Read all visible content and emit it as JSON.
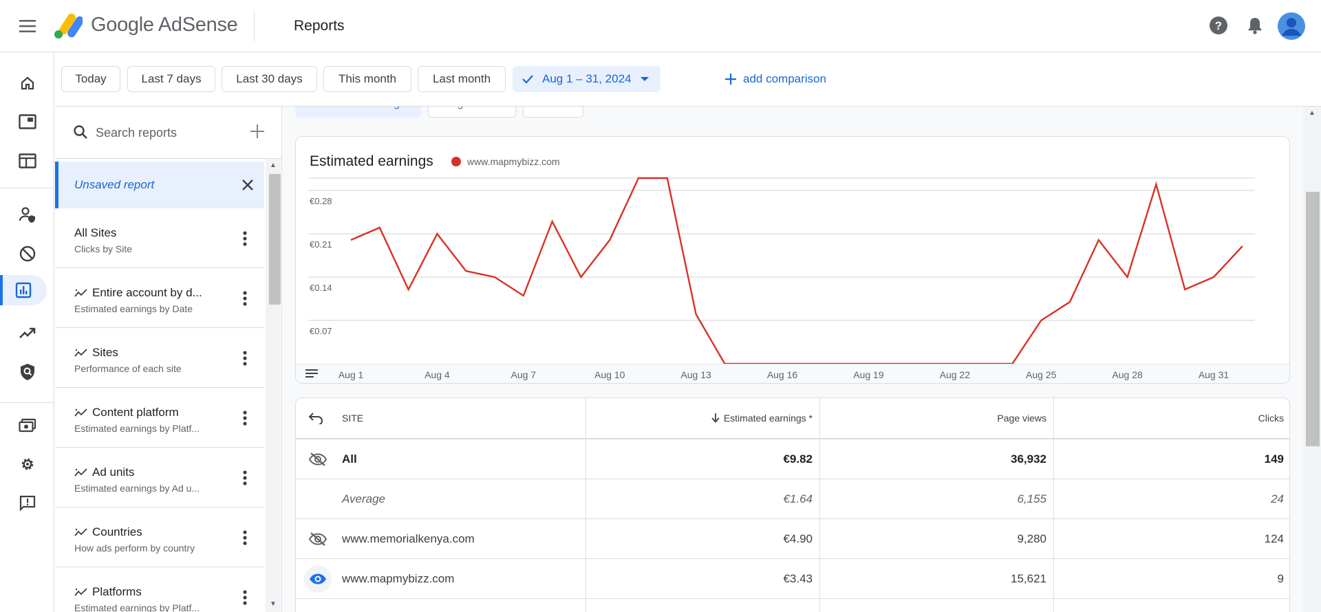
{
  "app": {
    "brand": "Google AdSense",
    "page_title": "Reports"
  },
  "icons": {
    "menu": "menu-icon",
    "help": "help-icon",
    "notifications": "bell-icon",
    "account": "avatar-icon",
    "rail": [
      "home-icon",
      "ad-unit-icon",
      "site-layout-icon",
      "privacy-user-icon",
      "block-icon",
      "reports-icon",
      "trending-icon",
      "policy-shield-icon",
      "payments-icon",
      "settings-icon",
      "feedback-icon"
    ]
  },
  "filters": {
    "chips": [
      "Today",
      "Last 7 days",
      "Last 30 days",
      "This month",
      "Last month"
    ],
    "selected_range": "Aug 1 – 31, 2024",
    "add_comparison": "add comparison"
  },
  "reports_panel": {
    "search_placeholder": "Search reports",
    "unsaved_label": "Unsaved report",
    "items": [
      {
        "title": "All Sites",
        "subtitle": "Clicks by Site",
        "pinned": false
      },
      {
        "title": "Entire account by d...",
        "subtitle": "Estimated earnings by Date",
        "pinned": true
      },
      {
        "title": "Sites",
        "subtitle": "Performance of each site",
        "pinned": true
      },
      {
        "title": "Content platform",
        "subtitle": "Estimated earnings by Platf...",
        "pinned": true
      },
      {
        "title": "Ad units",
        "subtitle": "Estimated earnings by Ad u...",
        "pinned": true
      },
      {
        "title": "Countries",
        "subtitle": "How ads perform by country",
        "pinned": true
      },
      {
        "title": "Platforms",
        "subtitle": "Estimated earnings by Platf...",
        "pinned": true
      }
    ]
  },
  "metric_tabs": [
    "Estimated earnings",
    "Page views",
    "Clicks"
  ],
  "chart_data": {
    "type": "line",
    "title": "Estimated earnings",
    "series": [
      {
        "name": "www.mapmybizz.com",
        "color": "#d93025",
        "values": [
          0.2,
          0.22,
          0.12,
          0.21,
          0.15,
          0.14,
          0.11,
          0.23,
          0.14,
          0.2,
          0.3,
          0.3,
          0.08,
          0.0,
          0.0,
          0.0,
          0.0,
          0.0,
          0.0,
          0.0,
          0.0,
          0.0,
          0.0,
          0.0,
          0.07,
          0.1,
          0.2,
          0.14,
          0.29,
          0.12,
          0.14,
          0.19
        ]
      }
    ],
    "x": [
      "Aug 1",
      "Aug 2",
      "Aug 3",
      "Aug 4",
      "Aug 5",
      "Aug 6",
      "Aug 7",
      "Aug 8",
      "Aug 9",
      "Aug 10",
      "Aug 11",
      "Aug 12",
      "Aug 13",
      "Aug 14",
      "Aug 15",
      "Aug 16",
      "Aug 17",
      "Aug 18",
      "Aug 19",
      "Aug 20",
      "Aug 21",
      "Aug 22",
      "Aug 23",
      "Aug 24",
      "Aug 25",
      "Aug 26",
      "Aug 27",
      "Aug 28",
      "Aug 29",
      "Aug 30",
      "Aug 31"
    ],
    "x_tick_labels": [
      "Aug 1",
      "Aug 4",
      "Aug 7",
      "Aug 10",
      "Aug 13",
      "Aug 16",
      "Aug 19",
      "Aug 22",
      "Aug 25",
      "Aug 28",
      "Aug 31"
    ],
    "y_ticks": [
      0.07,
      0.14,
      0.21,
      0.28
    ],
    "y_tick_labels": [
      "€0.07",
      "€0.14",
      "€0.21",
      "€0.28"
    ],
    "ylim": [
      0,
      0.3
    ],
    "grid": true,
    "legend": "top-left"
  },
  "table": {
    "headers": {
      "site": "SITE",
      "earnings": "Estimated earnings *",
      "pageviews": "Page views",
      "clicks": "Clicks"
    },
    "rows": [
      {
        "site": "All",
        "earnings": "€9.82",
        "pageviews": "36,932",
        "clicks": "149",
        "style": "total",
        "visible": false
      },
      {
        "site": "Average",
        "earnings": "€1.64",
        "pageviews": "6,155",
        "clicks": "24",
        "style": "average",
        "visible": null
      },
      {
        "site": "www.memorialkenya.com",
        "earnings": "€4.90",
        "pageviews": "9,280",
        "clicks": "124",
        "style": "normal",
        "visible": false
      },
      {
        "site": "www.mapmybizz.com",
        "earnings": "€3.43",
        "pageviews": "15,621",
        "clicks": "9",
        "style": "normal",
        "visible": true
      }
    ]
  },
  "colors": {
    "accent": "#1a73e8",
    "accent_bg": "#e8f0fe",
    "series": "#d93025"
  }
}
